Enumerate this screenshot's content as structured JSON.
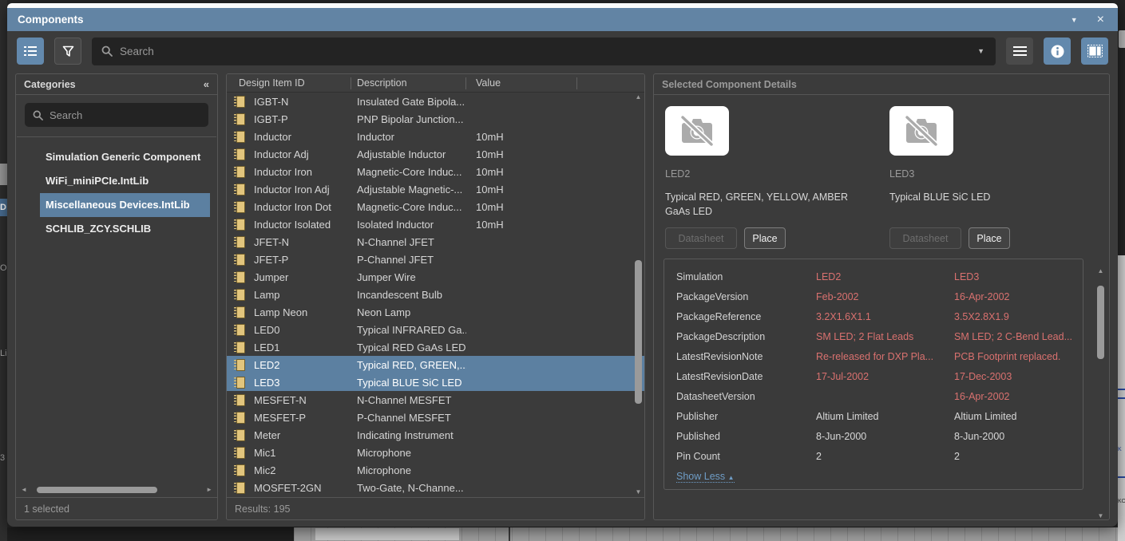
{
  "window": {
    "title": "Components",
    "menu_icon": "▼",
    "close_icon": "×"
  },
  "toolbar": {
    "search_placeholder": "Search",
    "search_value": "",
    "dropdown_icon": "▼"
  },
  "categories": {
    "header": "Categories",
    "collapse_icon": "«",
    "search_placeholder": "Search",
    "items": [
      {
        "label": "Simulation Generic Component",
        "selected": false
      },
      {
        "label": "WiFi_miniPCIe.IntLib",
        "selected": false
      },
      {
        "label": "Miscellaneous Devices.IntLib",
        "selected": true
      },
      {
        "label": "SCHLIB_ZCY.SCHLIB",
        "selected": false
      }
    ],
    "status": "1 selected"
  },
  "components_table": {
    "columns": [
      "Design Item ID",
      "Description",
      "Value"
    ],
    "rows": [
      {
        "id": "IGBT-N",
        "description": "Insulated Gate Bipola...",
        "value": "",
        "selected": false
      },
      {
        "id": "IGBT-P",
        "description": "PNP Bipolar Junction...",
        "value": "",
        "selected": false
      },
      {
        "id": "Inductor",
        "description": "Inductor",
        "value": "10mH",
        "selected": false
      },
      {
        "id": "Inductor Adj",
        "description": "Adjustable Inductor",
        "value": "10mH",
        "selected": false
      },
      {
        "id": "Inductor Iron",
        "description": "Magnetic-Core Induc...",
        "value": "10mH",
        "selected": false
      },
      {
        "id": "Inductor Iron Adj",
        "description": "Adjustable Magnetic-...",
        "value": "10mH",
        "selected": false
      },
      {
        "id": "Inductor Iron Dot",
        "description": "Magnetic-Core Induc...",
        "value": "10mH",
        "selected": false
      },
      {
        "id": "Inductor Isolated",
        "description": "Isolated Inductor",
        "value": "10mH",
        "selected": false
      },
      {
        "id": "JFET-N",
        "description": "N-Channel JFET",
        "value": "",
        "selected": false
      },
      {
        "id": "JFET-P",
        "description": "P-Channel JFET",
        "value": "",
        "selected": false
      },
      {
        "id": "Jumper",
        "description": "Jumper Wire",
        "value": "",
        "selected": false
      },
      {
        "id": "Lamp",
        "description": "Incandescent Bulb",
        "value": "",
        "selected": false
      },
      {
        "id": "Lamp Neon",
        "description": "Neon Lamp",
        "value": "",
        "selected": false
      },
      {
        "id": "LED0",
        "description": "Typical INFRARED Ga...",
        "value": "",
        "selected": false
      },
      {
        "id": "LED1",
        "description": "Typical RED GaAs LED",
        "value": "",
        "selected": false
      },
      {
        "id": "LED2",
        "description": "Typical RED, GREEN,...",
        "value": "",
        "selected": true
      },
      {
        "id": "LED3",
        "description": "Typical BLUE SiC LED",
        "value": "",
        "selected": true
      },
      {
        "id": "MESFET-N",
        "description": "N-Channel MESFET",
        "value": "",
        "selected": false
      },
      {
        "id": "MESFET-P",
        "description": "P-Channel MESFET",
        "value": "",
        "selected": false
      },
      {
        "id": "Meter",
        "description": "Indicating Instrument",
        "value": "",
        "selected": false
      },
      {
        "id": "Mic1",
        "description": "Microphone",
        "value": "",
        "selected": false
      },
      {
        "id": "Mic2",
        "description": "Microphone",
        "value": "",
        "selected": false
      },
      {
        "id": "MOSFET-2GN",
        "description": "Two-Gate, N-Channe...",
        "value": "",
        "selected": false
      }
    ],
    "status": "Results: 195"
  },
  "details": {
    "header": "Selected Component Details",
    "components": [
      {
        "name": "LED2",
        "description": "Typical RED, GREEN, YELLOW, AMBER GaAs LED",
        "datasheet_label": "Datasheet",
        "place_label": "Place"
      },
      {
        "name": "LED3",
        "description": "Typical BLUE SiC LED",
        "datasheet_label": "Datasheet",
        "place_label": "Place"
      }
    ],
    "properties": [
      {
        "name": "Simulation",
        "val1": "LED2",
        "val2": "LED3",
        "highlight": true
      },
      {
        "name": "PackageVersion",
        "val1": "Feb-2002",
        "val2": "16-Apr-2002",
        "highlight": true
      },
      {
        "name": "PackageReference",
        "val1": "3.2X1.6X1.1",
        "val2": "3.5X2.8X1.9",
        "highlight": true
      },
      {
        "name": "PackageDescription",
        "val1": "SM LED; 2 Flat Leads",
        "val2": "SM LED; 2 C-Bend Lead...",
        "highlight": true
      },
      {
        "name": "LatestRevisionNote",
        "val1": "Re-released for DXP Pla...",
        "val2": "PCB Footprint replaced.",
        "highlight": true
      },
      {
        "name": "LatestRevisionDate",
        "val1": "17-Jul-2002",
        "val2": "17-Dec-2003",
        "highlight": true
      },
      {
        "name": "DatasheetVersion",
        "val1": "",
        "val2": "16-Apr-2002",
        "highlight": true
      },
      {
        "name": "Publisher",
        "val1": "Altium Limited",
        "val2": "Altium Limited",
        "highlight": false
      },
      {
        "name": "Published",
        "val1": "8-Jun-2000",
        "val2": "8-Jun-2000",
        "highlight": false
      },
      {
        "name": "Pin Count",
        "val1": "2",
        "val2": "2",
        "highlight": false
      }
    ],
    "show_less_label": "Show Less",
    "show_less_arrow": "▲"
  },
  "background": {
    "left_fragments": [
      "D",
      "Oc",
      "Li",
      "3"
    ],
    "right_fragments": [
      "K",
      "KO"
    ]
  },
  "colors": {
    "titlebar_blue": "#6284a4",
    "accent_blue": "#6389ad",
    "selection_blue": "#5c80a1",
    "highlight_red": "#d9716f",
    "link_blue": "#6f9dc6",
    "chip_gold": "#e2c57d"
  }
}
